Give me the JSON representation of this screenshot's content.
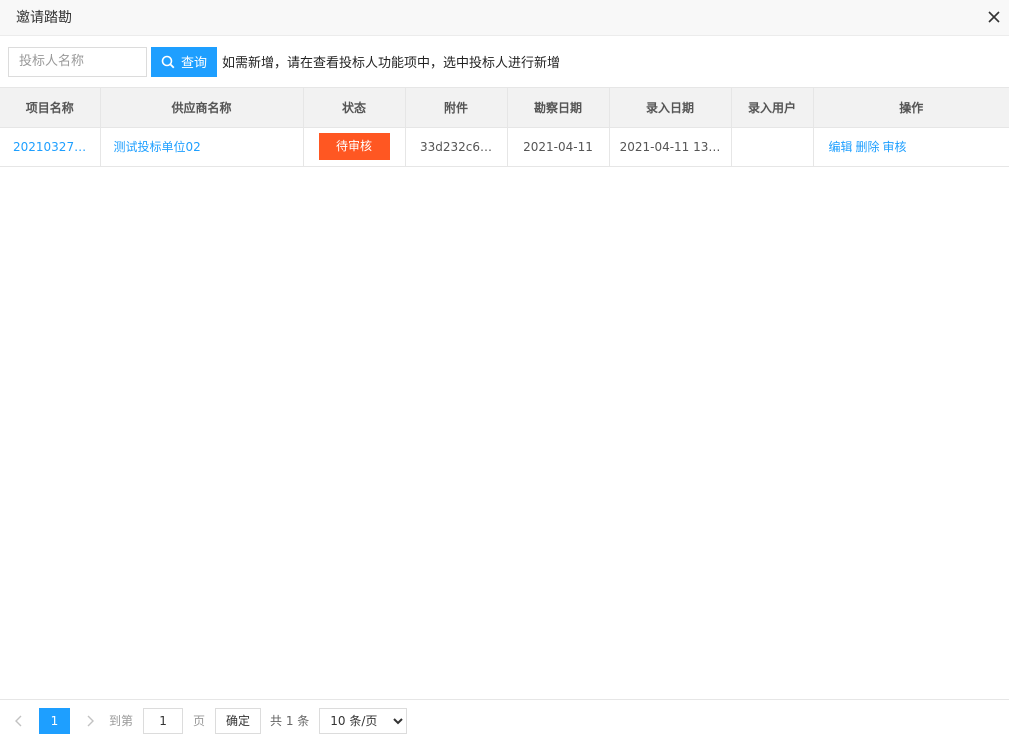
{
  "dialog": {
    "title": "邀请踏勘"
  },
  "toolbar": {
    "search_placeholder": "投标人名称",
    "query_label": "查询",
    "hint": "如需新增，请在查看投标人功能项中，选中投标人进行新增"
  },
  "table": {
    "columns": [
      "项目名称",
      "供应商名称",
      "状态",
      "附件",
      "勘察日期",
      "录入日期",
      "录入用户",
      "操作"
    ],
    "rows": [
      {
        "project": "20210327…",
        "supplier": "测试投标单位02",
        "status": "待审核",
        "attachment": "33d232c6…",
        "survey_date": "2021-04-11",
        "entry_date": "2021-04-11 13…",
        "entry_user": "",
        "actions": [
          "编辑",
          "删除",
          "审核"
        ]
      }
    ]
  },
  "pagination": {
    "current_page": "1",
    "goto_label": "到第",
    "goto_value": "1",
    "page_unit": "页",
    "confirm_label": "确定",
    "total": "共 1 条",
    "per_page": "10 条/页",
    "per_page_options": [
      "10 条/页"
    ]
  },
  "colors": {
    "primary": "#1e9fff",
    "status_pending": "#ff5722"
  },
  "icons": {
    "close": "close-icon",
    "search": "search-icon",
    "prev": "chevron-left-icon",
    "next": "chevron-right-icon"
  }
}
